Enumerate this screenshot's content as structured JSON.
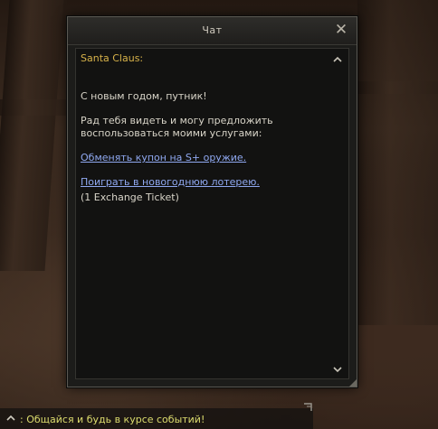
{
  "window": {
    "title": "Чат",
    "close_icon": "close-icon"
  },
  "dialog": {
    "speaker": "Santa Claus:",
    "greeting": "С новым годом, путник!",
    "offer_line1": "Рад тебя видеть и могу предложить",
    "offer_line2": "воспользоваться моими услугами:",
    "link_exchange": "Обменять купон на S+ оружие.",
    "link_lottery": "Поиграть в новогоднюю лотерею.",
    "lottery_cost": "(1 Exchange Ticket)"
  },
  "chat": {
    "message": ": Общайся и будь в курсе событий!"
  },
  "colors": {
    "speaker": "#d7b24a",
    "link": "#8fa8f0",
    "text": "#d8d4c8",
    "chat_text": "#dcdc6e"
  }
}
